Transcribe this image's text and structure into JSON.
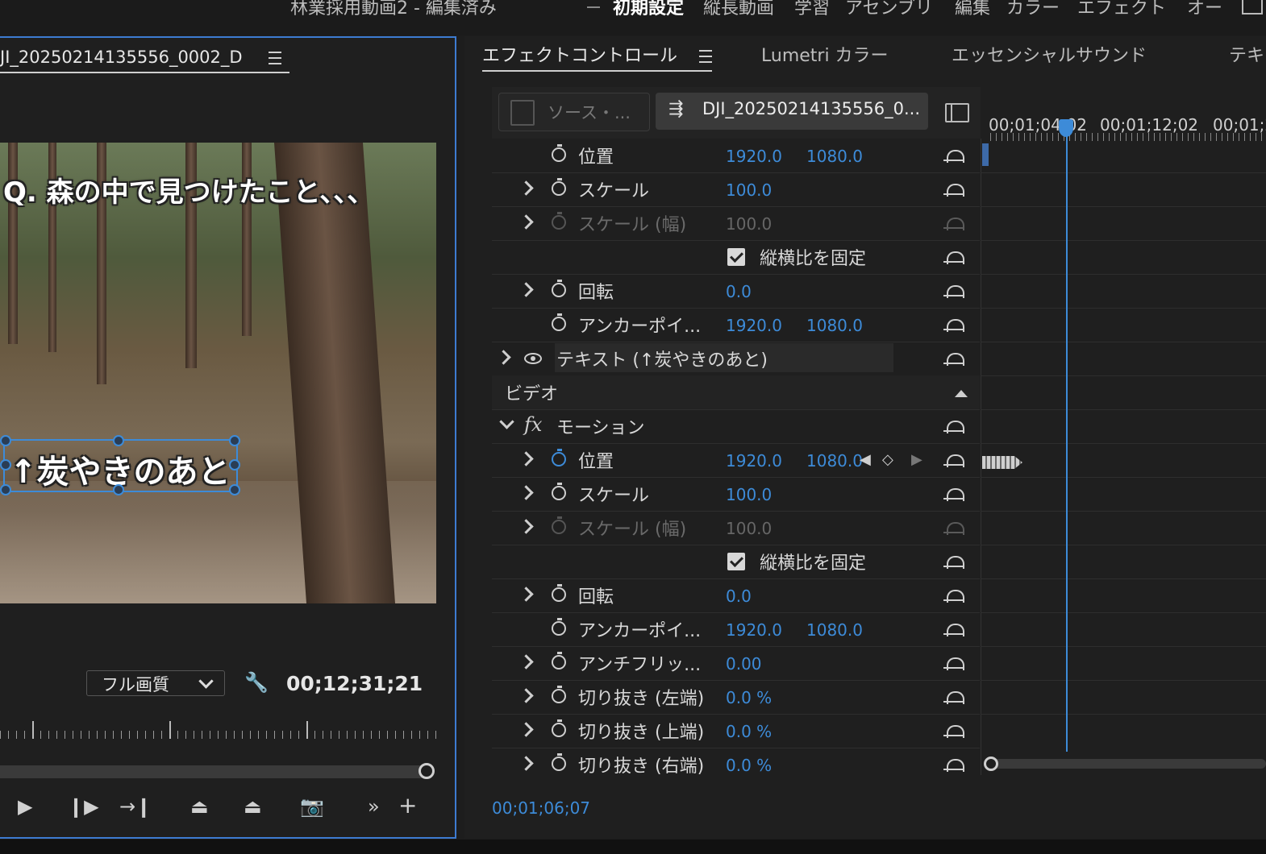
{
  "topbar": {
    "project_title": "林業採用動画2 - 編集済み",
    "workspaces": [
      "初期設定",
      "縦長動画",
      "学習",
      "アセンブリ",
      "編集",
      "カラー",
      "エフェクト",
      "オー"
    ]
  },
  "monitor": {
    "tab_label": "JI_20250214135556_0002_D",
    "video_text_question": "Q. 森の中で見つけたこと、、、",
    "video_text_subtitle": "↑炭やきのあと",
    "quality": "フル画質",
    "timecode": "00;12;31;21"
  },
  "effect_controls": {
    "tabs": [
      "エフェクトコントロール",
      "Lumetri カラー",
      "エッセンシャルサウンド",
      "テキ"
    ],
    "source_label": "ソース・...",
    "clip_label": "DJI_20250214135556_0...",
    "rows_top": [
      {
        "label": "位置",
        "v1": "1920.0",
        "v2": "1080.0"
      },
      {
        "label": "スケール",
        "v1": "100.0"
      },
      {
        "label": "スケール (幅)",
        "v1": "100.0"
      },
      {
        "checkbox": "縦横比を固定"
      },
      {
        "label": "回転",
        "v1": "0.0"
      },
      {
        "label": "アンカーポイ...",
        "v1": "1920.0",
        "v2": "1080.0"
      }
    ],
    "text_layer_label": "テキスト (↑炭やきのあと)",
    "video_section": "ビデオ",
    "motion_label": "モーション",
    "rows_motion": [
      {
        "label": "位置",
        "v1": "1920.0",
        "v2": "1080.0"
      },
      {
        "label": "スケール",
        "v1": "100.0"
      },
      {
        "label": "スケール (幅)",
        "v1": "100.0"
      },
      {
        "checkbox": "縦横比を固定"
      },
      {
        "label": "回転",
        "v1": "0.0"
      },
      {
        "label": "アンカーポイ...",
        "v1": "1920.0",
        "v2": "1080.0"
      },
      {
        "label": "アンチフリッ...",
        "v1": "0.00"
      },
      {
        "label": "切り抜き (左端)",
        "v1": "0.0 %"
      },
      {
        "label": "切り抜き (上端)",
        "v1": "0.0 %"
      },
      {
        "label": "切り抜き (右端)",
        "v1": "0.0 %"
      }
    ],
    "timeline_labels": [
      "00;01;04;02",
      "00;01;12;02",
      "00;01;2"
    ],
    "current_timecode": "00;01;06;07"
  }
}
